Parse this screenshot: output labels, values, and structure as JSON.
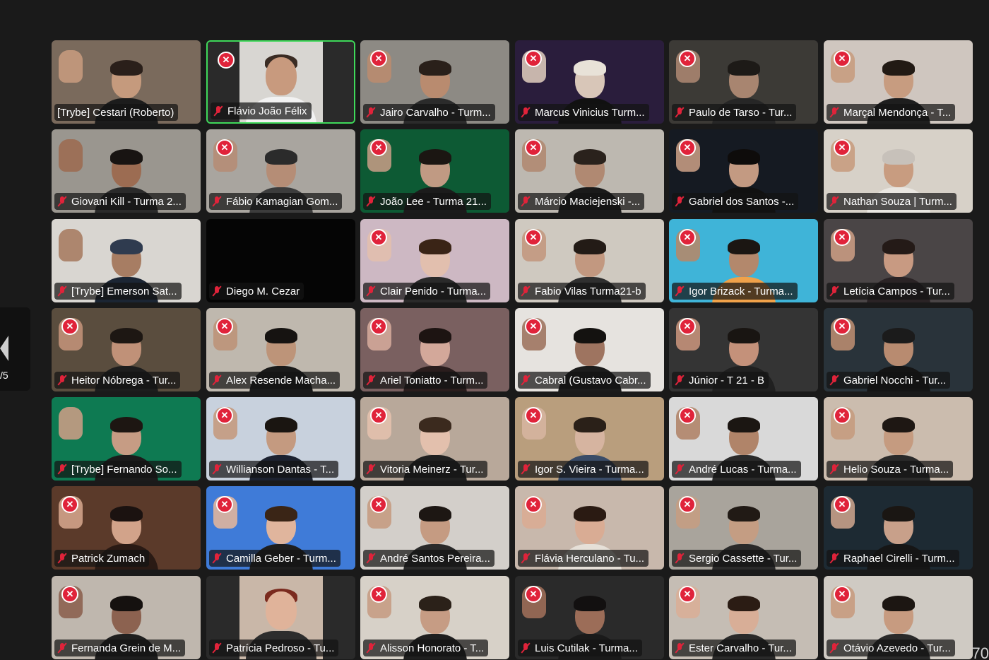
{
  "pager": {
    "page_label": "/5"
  },
  "corner_count": "70",
  "participants": [
    {
      "name": "[Trybe] Cestari (Roberto)",
      "muted": false,
      "x_badge": false,
      "active": false,
      "video": true,
      "bg": "#7a6a5c",
      "skin": "#c59a7d",
      "shirt": "#1c1c1c",
      "hair": "#2a1f1a"
    },
    {
      "name": "Flávio João Félix",
      "muted": true,
      "x_badge": true,
      "active": true,
      "video": "photo",
      "bg": "#2a2a2a",
      "photo_bg": "#d8d6d2",
      "skin": "#c89a7e",
      "shirt": "#f2f2f2",
      "hair": "#3a2c24"
    },
    {
      "name": "Jairo Carvalho - Turm...",
      "muted": true,
      "x_badge": true,
      "active": false,
      "video": true,
      "bg": "#8d8a84",
      "skin": "#b98b6f",
      "shirt": "#2b2b2b",
      "hair": "#2a201a"
    },
    {
      "name": "Marcus Vinicius Turm...",
      "muted": true,
      "x_badge": true,
      "active": false,
      "video": true,
      "bg": "#2a1d3c",
      "skin": "#d8c6b8",
      "shirt": "#111111",
      "hair": "#e8e2d8"
    },
    {
      "name": "Paulo de Tarso - Tur...",
      "muted": true,
      "x_badge": true,
      "active": false,
      "video": true,
      "bg": "#3c3a36",
      "skin": "#a88570",
      "shirt": "#262626",
      "hair": "#1d1a17"
    },
    {
      "name": "Marçal Mendonça - T...",
      "muted": true,
      "x_badge": true,
      "active": false,
      "video": true,
      "bg": "#cfc6bf",
      "skin": "#c79c80",
      "shirt": "#1e1e1e",
      "hair": "#221a14"
    },
    {
      "name": "Giovani Kill - Turma 2...",
      "muted": true,
      "x_badge": false,
      "active": false,
      "video": true,
      "bg": "#9a968f",
      "skin": "#9c6c52",
      "shirt": "#2a2a2a",
      "hair": "#181412"
    },
    {
      "name": "Fábio Kamagian Gom...",
      "muted": true,
      "x_badge": true,
      "active": false,
      "video": true,
      "bg": "#a9a59f",
      "skin": "#b58d76",
      "shirt": "#3c3c3c",
      "hair": "#2b2b2b"
    },
    {
      "name": "João Lee - Turma 21...",
      "muted": true,
      "x_badge": true,
      "active": false,
      "video": true,
      "bg": "#0d5a34",
      "skin": "#c09a83",
      "shirt": "#1b1b1b",
      "hair": "#1b1612"
    },
    {
      "name": "Márcio Maciejenski -...",
      "muted": true,
      "x_badge": true,
      "active": false,
      "video": true,
      "bg": "#bdb8b0",
      "skin": "#b08972",
      "shirt": "#1a1a1a",
      "hair": "#2a221c"
    },
    {
      "name": "Gabriel dos Santos -...",
      "muted": true,
      "x_badge": true,
      "active": false,
      "video": true,
      "bg": "#151a22",
      "skin": "#c39a82",
      "shirt": "#111111",
      "hair": "#0e0c0b"
    },
    {
      "name": "Nathan Souza | Turm...",
      "muted": true,
      "x_badge": true,
      "active": false,
      "video": true,
      "bg": "#d7d1c8",
      "skin": "#c89c80",
      "shirt": "#e9e6e1",
      "hair": "#c7c1ba"
    },
    {
      "name": "[Trybe] Emerson Sat...",
      "muted": true,
      "x_badge": false,
      "active": false,
      "video": true,
      "bg": "#d9d6d1",
      "skin": "#a77d63",
      "shirt": "#1b2533",
      "hair": "#2f3b4f"
    },
    {
      "name": "Diego M. Cezar",
      "muted": true,
      "x_badge": false,
      "active": false,
      "video": false,
      "bg": "#050505",
      "skin": "#000000",
      "shirt": "#000000",
      "hair": "#000000"
    },
    {
      "name": "Clair Penido - Turma...",
      "muted": true,
      "x_badge": true,
      "active": false,
      "video": true,
      "bg": "#cdb8c3",
      "skin": "#e2bfae",
      "shirt": "#2a2a2a",
      "hair": "#3a2416"
    },
    {
      "name": "Fabio Vilas Turma21-b",
      "muted": true,
      "x_badge": true,
      "active": false,
      "video": true,
      "bg": "#cfc9c0",
      "skin": "#c29880",
      "shirt": "#2f2f2f",
      "hair": "#231b16"
    },
    {
      "name": "Igor Brizack - Turma...",
      "muted": true,
      "x_badge": true,
      "active": false,
      "video": true,
      "bg": "#3fb4d8",
      "skin": "#b3886c",
      "shirt": "#f0a24a",
      "hair": "#1b1612"
    },
    {
      "name": "Letícia Campos - Tur...",
      "muted": true,
      "x_badge": true,
      "active": false,
      "video": true,
      "bg": "#4a4546",
      "skin": "#c89a82",
      "shirt": "#2a2325",
      "hair": "#241a17"
    },
    {
      "name": "Heitor Nóbrega - Tur...",
      "muted": true,
      "x_badge": true,
      "active": false,
      "video": true,
      "bg": "#5a4d3e",
      "skin": "#c09178",
      "shirt": "#1d1d1d",
      "hair": "#1d1713"
    },
    {
      "name": "Alex Resende Macha...",
      "muted": true,
      "x_badge": true,
      "active": false,
      "video": true,
      "bg": "#bfb8ae",
      "skin": "#bd9479",
      "shirt": "#1a1a1a",
      "hair": "#161311"
    },
    {
      "name": "Ariel Toniatto - Turm...",
      "muted": true,
      "x_badge": true,
      "active": false,
      "video": true,
      "bg": "#7a6060",
      "skin": "#d3a89a",
      "shirt": "#2a1d1d",
      "hair": "#1d1412"
    },
    {
      "name": "Cabral (Gustavo Cabr...",
      "muted": true,
      "x_badge": true,
      "active": false,
      "video": true,
      "bg": "#e6e3df",
      "skin": "#9e7460",
      "shirt": "#1c1c1c",
      "hair": "#141210"
    },
    {
      "name": "Júnior - T 21 - B",
      "muted": true,
      "x_badge": true,
      "active": false,
      "video": true,
      "bg": "#343434",
      "skin": "#c4917a",
      "shirt": "#202020",
      "hair": "#191512"
    },
    {
      "name": "Gabriel Nocchi - Tur...",
      "muted": true,
      "x_badge": true,
      "active": false,
      "video": true,
      "bg": "#29333a",
      "skin": "#b88b70",
      "shirt": "#151515",
      "hair": "#1b1b1b"
    },
    {
      "name": "[Trybe] Fernando So...",
      "muted": true,
      "x_badge": false,
      "active": false,
      "video": true,
      "bg": "#0e7a52",
      "skin": "#c69c84",
      "shirt": "#1b1b1b",
      "hair": "#1d1612"
    },
    {
      "name": "Willianson Dantas - T...",
      "muted": true,
      "x_badge": true,
      "active": false,
      "video": true,
      "bg": "#c8d1dd",
      "skin": "#c49a80",
      "shirt": "#1c2230",
      "hair": "#1a1511"
    },
    {
      "name": "Vitoria Meinerz - Tur...",
      "muted": true,
      "x_badge": true,
      "active": false,
      "video": true,
      "bg": "#b8a89a",
      "skin": "#e3c0ad",
      "shirt": "#202020",
      "hair": "#3b2a1e"
    },
    {
      "name": "Igor S. Vieira - Turma...",
      "muted": true,
      "x_badge": true,
      "active": false,
      "video": true,
      "bg": "#b99e7d",
      "skin": "#d6b4a0",
      "shirt": "#3a4c68",
      "hair": "#2a2018"
    },
    {
      "name": "André Lucas - Turma...",
      "muted": true,
      "x_badge": true,
      "active": false,
      "video": true,
      "bg": "#d9d9d9",
      "skin": "#b08469",
      "shirt": "#2a2a2a",
      "hair": "#1b1612"
    },
    {
      "name": "Helio Souza - Turma...",
      "muted": true,
      "x_badge": true,
      "active": false,
      "video": true,
      "bg": "#cbbcae",
      "skin": "#c59b80",
      "shirt": "#2a2a2a",
      "hair": "#1e1713"
    },
    {
      "name": "Patrick Zumach",
      "muted": true,
      "x_badge": true,
      "active": false,
      "video": true,
      "bg": "#5b3a2a",
      "skin": "#d2a38a",
      "shirt": "#2a1a14",
      "hair": "#1b1210"
    },
    {
      "name": "Camilla Geber - Turm...",
      "muted": true,
      "x_badge": true,
      "active": false,
      "video": true,
      "bg": "#3f7bd8",
      "skin": "#e0b59d",
      "shirt": "#1e1e1e",
      "hair": "#3a2516"
    },
    {
      "name": "André Santos Pereira...",
      "muted": true,
      "x_badge": true,
      "active": false,
      "video": true,
      "bg": "#d3cfca",
      "skin": "#c59b82",
      "shirt": "#2a2a2a",
      "hair": "#1d1713"
    },
    {
      "name": "Flávia Herculano - Tu...",
      "muted": true,
      "x_badge": true,
      "active": false,
      "video": true,
      "bg": "#c8b8ac",
      "skin": "#d9ac94",
      "shirt": "#e6e0d8",
      "hair": "#2a1a12"
    },
    {
      "name": "Sergio Cassette - Tur...",
      "muted": true,
      "x_badge": true,
      "active": false,
      "video": true,
      "bg": "#a9a49c",
      "skin": "#c49d83",
      "shirt": "#2a2a2a",
      "hair": "#211a15"
    },
    {
      "name": "Raphael Cirelli - Turm...",
      "muted": true,
      "x_badge": true,
      "active": false,
      "video": true,
      "bg": "#1d2a33",
      "skin": "#c8a08a",
      "shirt": "#161616",
      "hair": "#1a1613"
    },
    {
      "name": "Fernanda Grein de M...",
      "muted": true,
      "x_badge": true,
      "active": false,
      "video": true,
      "bg": "#bfb7ae",
      "skin": "#8c6250",
      "shirt": "#1f1f1f",
      "hair": "#15110f"
    },
    {
      "name": "Patrícia Pedroso - Tu...",
      "muted": true,
      "x_badge": false,
      "active": false,
      "video": "photo",
      "bg": "#2a2a2a",
      "photo_bg": "#c9b7a8",
      "skin": "#e0b39a",
      "shirt": "#2d2d2d",
      "hair": "#7a2a1e"
    },
    {
      "name": "Alisson Honorato - T...",
      "muted": true,
      "x_badge": true,
      "active": false,
      "video": true,
      "bg": "#d7d1c8",
      "skin": "#c69c84",
      "shirt": "#1f1f1f",
      "hair": "#2b2119"
    },
    {
      "name": "Luis Cutilak - Turma...",
      "muted": true,
      "x_badge": true,
      "active": false,
      "video": true,
      "bg": "#2a2a2a",
      "skin": "#9c6d58",
      "shirt": "#1a1a1a",
      "hair": "#121010"
    },
    {
      "name": "Ester Carvalho - Tur...",
      "muted": true,
      "x_badge": true,
      "active": false,
      "video": true,
      "bg": "#c5bdb4",
      "skin": "#d8ae97",
      "shirt": "#2a2a2a",
      "hair": "#2b1c14"
    },
    {
      "name": "Otávio Azevedo - Tur...",
      "muted": true,
      "x_badge": true,
      "active": false,
      "video": true,
      "bg": "#cfcac3",
      "skin": "#c79b80",
      "shirt": "#2a2a2a",
      "hair": "#1c1612"
    }
  ]
}
